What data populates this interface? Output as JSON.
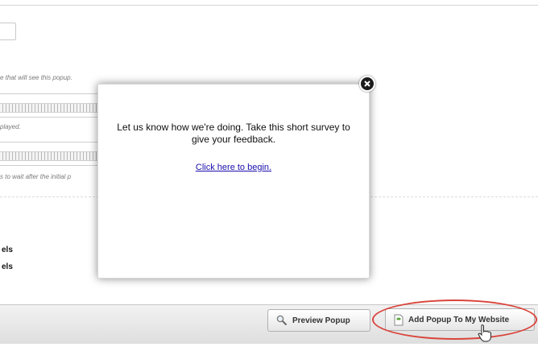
{
  "settings": {
    "hint_audience": "e that will see this popup.",
    "hint_display": "played.",
    "hint_delay": "s to wait after the initial p",
    "label_1": "els",
    "label_2": "els"
  },
  "popup": {
    "message": "Let us know how we're doing. Take this short survey to give your feedback.",
    "link_text": "Click here to begin."
  },
  "footer": {
    "preview_button": "Preview Popup",
    "add_button": "Add Popup To My Website"
  },
  "icons": {
    "close": "close-icon",
    "preview": "magnifier-icon",
    "add": "page-icon",
    "cursor": "hand-pointer-icon"
  },
  "colors": {
    "highlight_ellipse": "#d9453b",
    "link": "#1a0dab"
  }
}
